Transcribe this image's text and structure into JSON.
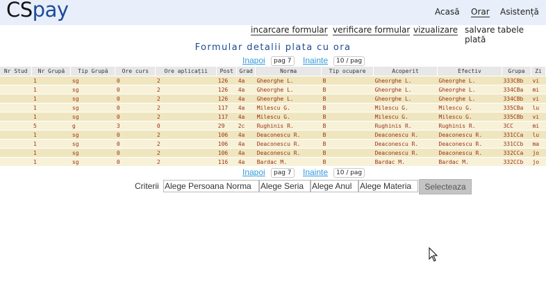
{
  "app": {
    "logo_cs": "CS",
    "logo_pay": "pay"
  },
  "topnav": {
    "acasa": "Acasă",
    "orar": "Orar",
    "asistenta": "Asistență"
  },
  "subnav": {
    "incarcare": "incarcare formular",
    "verificare": "verificare formular",
    "vizualizare": "vizualizare",
    "salvare": "salvare tabele plată"
  },
  "page_title": "Formular detalii plata cu ora",
  "pager": {
    "prev": "Inapoi",
    "page": "pag 7",
    "next": "Inainte",
    "per_page": "10 / pag"
  },
  "table": {
    "headers": [
      "Nr Stud",
      "Nr Grupă",
      "Tip Grupă",
      "Ore curs",
      "Ore aplicații",
      "Post",
      "Grad",
      "Norma",
      "Tip ocupare",
      "Acoperit",
      "Efectiv",
      "Grupa",
      "Zi"
    ],
    "rows": [
      [
        "",
        "1",
        "sg",
        "0",
        "2",
        "126",
        "4a",
        "Gheorghe L.",
        "B",
        "Gheorghe L.",
        "Gheorghe L.",
        "333CBb",
        "vi"
      ],
      [
        "",
        "1",
        "sg",
        "0",
        "2",
        "126",
        "4a",
        "Gheorghe L.",
        "B",
        "Gheorghe L.",
        "Gheorghe L.",
        "334CBa",
        "mi"
      ],
      [
        "",
        "1",
        "sg",
        "0",
        "2",
        "126",
        "4a",
        "Gheorghe L.",
        "B",
        "Gheorghe L.",
        "Gheorghe L.",
        "334CBb",
        "vi"
      ],
      [
        "",
        "1",
        "sg",
        "0",
        "2",
        "117",
        "4a",
        "Milescu G.",
        "B",
        "Milescu G.",
        "Milescu G.",
        "335CBa",
        "lu"
      ],
      [
        "",
        "1",
        "sg",
        "0",
        "2",
        "117",
        "4a",
        "Milescu G.",
        "B",
        "Milescu G.",
        "Milescu G.",
        "335CBb",
        "vi"
      ],
      [
        "",
        "5",
        "g",
        "3",
        "0",
        "29",
        "2c",
        "Rughinis R.",
        "B",
        "Rughinis R.",
        "Rughinis R.",
        "3CC",
        "mi"
      ],
      [
        "",
        "1",
        "sg",
        "0",
        "2",
        "106",
        "4a",
        "Deaconescu R.",
        "B",
        "Deaconescu R.",
        "Deaconescu R.",
        "331CCa",
        "lu"
      ],
      [
        "",
        "1",
        "sg",
        "0",
        "2",
        "106",
        "4a",
        "Deaconescu R.",
        "B",
        "Deaconescu R.",
        "Deaconescu R.",
        "331CCb",
        "ma"
      ],
      [
        "",
        "1",
        "sg",
        "0",
        "2",
        "106",
        "4a",
        "Deaconescu R.",
        "B",
        "Deaconescu R.",
        "Deaconescu R.",
        "332CCa",
        "jo"
      ],
      [
        "",
        "1",
        "sg",
        "0",
        "2",
        "116",
        "4a",
        "Bardac M.",
        "B",
        "Bardac M.",
        "Bardac M.",
        "332CCb",
        "jo"
      ]
    ]
  },
  "criteria": {
    "label": "Criterii",
    "persoana": "Alege Persoana Norma",
    "seria": "Alege Seria",
    "anul": "Alege Anul",
    "materia": "Alege Materia",
    "button": "Selecteaza"
  },
  "colors": {
    "header_bg": "#e8eefa",
    "link": "#3399dd",
    "title": "#1a4a8f",
    "row_odd": "#efe6bf",
    "row_even": "#f7f1d8",
    "cell_text": "#993311"
  }
}
